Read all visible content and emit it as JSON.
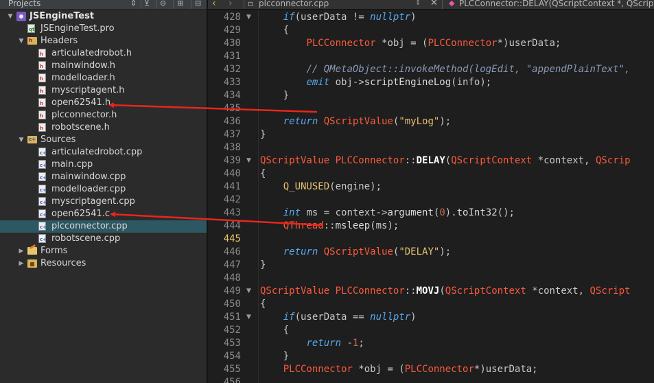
{
  "projects_panel": {
    "title": "Projects",
    "toolbar_icons": [
      "chevron-updown-icon",
      "filter-icon",
      "link-icon",
      "split-icon",
      "close-panel-icon"
    ],
    "tree": [
      {
        "label": "JSEngineTest",
        "depth": 0,
        "kind": "project",
        "expanded": true,
        "bold": true
      },
      {
        "label": "JSEngineTest.pro",
        "depth": 1,
        "kind": "pro"
      },
      {
        "label": "Headers",
        "depth": 1,
        "kind": "folder-h",
        "expanded": true
      },
      {
        "label": "articulatedrobot.h",
        "depth": 2,
        "kind": "h"
      },
      {
        "label": "mainwindow.h",
        "depth": 2,
        "kind": "h"
      },
      {
        "label": "modelloader.h",
        "depth": 2,
        "kind": "h"
      },
      {
        "label": "myscriptagent.h",
        "depth": 2,
        "kind": "h"
      },
      {
        "label": "open62541.h",
        "depth": 2,
        "kind": "h"
      },
      {
        "label": "plcconnector.h",
        "depth": 2,
        "kind": "h"
      },
      {
        "label": "robotscene.h",
        "depth": 2,
        "kind": "h"
      },
      {
        "label": "Sources",
        "depth": 1,
        "kind": "folder-c",
        "expanded": true
      },
      {
        "label": "articulatedrobot.cpp",
        "depth": 2,
        "kind": "c"
      },
      {
        "label": "main.cpp",
        "depth": 2,
        "kind": "c"
      },
      {
        "label": "mainwindow.cpp",
        "depth": 2,
        "kind": "c"
      },
      {
        "label": "modelloader.cpp",
        "depth": 2,
        "kind": "c"
      },
      {
        "label": "myscriptagent.cpp",
        "depth": 2,
        "kind": "c"
      },
      {
        "label": "open62541.c",
        "depth": 2,
        "kind": "c"
      },
      {
        "label": "plcconnector.cpp",
        "depth": 2,
        "kind": "c",
        "selected": true
      },
      {
        "label": "robotscene.cpp",
        "depth": 2,
        "kind": "c"
      },
      {
        "label": "Forms",
        "depth": 1,
        "kind": "folder-forms",
        "expanded": false
      },
      {
        "label": "Resources",
        "depth": 1,
        "kind": "folder-res",
        "expanded": false
      }
    ]
  },
  "editor": {
    "nav_back": "‹",
    "nav_forward": "›",
    "file_name": "plcconnector.cpp",
    "function_crumb": "PLCConnector::DELAY(QScriptContext *, QScriptE",
    "current_line": 445,
    "lines": [
      {
        "n": 428,
        "fold": true,
        "tokens": [
          [
            "    ",
            ""
          ],
          [
            "if",
            "kw"
          ],
          [
            "(userData != ",
            "id"
          ],
          [
            "nullptr",
            "kw"
          ],
          [
            ")",
            "id"
          ]
        ]
      },
      {
        "n": 429,
        "fold": false,
        "tokens": [
          [
            "    {",
            "id"
          ]
        ]
      },
      {
        "n": 430,
        "fold": false,
        "tokens": [
          [
            "        ",
            ""
          ],
          [
            "PLCConnector",
            "ty"
          ],
          [
            " *obj = (",
            "id"
          ],
          [
            "PLCConnector",
            "ty"
          ],
          [
            "*)userData;",
            "id"
          ]
        ]
      },
      {
        "n": 431,
        "fold": false,
        "tokens": []
      },
      {
        "n": 432,
        "fold": false,
        "tokens": [
          [
            "        ",
            ""
          ],
          [
            "// QMetaObject::invokeMethod(logEdit, \"appendPlainText\",",
            "cm"
          ]
        ]
      },
      {
        "n": 433,
        "fold": false,
        "tokens": [
          [
            "        ",
            ""
          ],
          [
            "emit",
            "kw"
          ],
          [
            " obj->",
            "id"
          ],
          [
            "scriptEngineLog",
            "fn"
          ],
          [
            "(info);",
            "id"
          ]
        ]
      },
      {
        "n": 434,
        "fold": false,
        "tokens": [
          [
            "    }",
            "id"
          ]
        ]
      },
      {
        "n": 435,
        "fold": false,
        "tokens": []
      },
      {
        "n": 436,
        "fold": false,
        "tokens": [
          [
            "    ",
            ""
          ],
          [
            "return",
            "kw"
          ],
          [
            " ",
            "id"
          ],
          [
            "QScriptValue",
            "ty"
          ],
          [
            "(",
            "id"
          ],
          [
            "\"myLog\"",
            "str"
          ],
          [
            ");",
            "id"
          ]
        ]
      },
      {
        "n": 437,
        "fold": false,
        "tokens": [
          [
            "}",
            "id"
          ]
        ]
      },
      {
        "n": 438,
        "fold": false,
        "tokens": []
      },
      {
        "n": 439,
        "fold": true,
        "tokens": [
          [
            "QScriptValue",
            "ty"
          ],
          [
            " ",
            "id"
          ],
          [
            "PLCConnector",
            "ty"
          ],
          [
            "::",
            "id"
          ],
          [
            "DELAY",
            "fnb"
          ],
          [
            "(",
            "id"
          ],
          [
            "QScriptContext",
            "ty"
          ],
          [
            " *context, ",
            "id"
          ],
          [
            "QScrip",
            "ty"
          ]
        ]
      },
      {
        "n": 440,
        "fold": false,
        "tokens": [
          [
            "{",
            "id"
          ]
        ]
      },
      {
        "n": 441,
        "fold": false,
        "tokens": [
          [
            "    ",
            ""
          ],
          [
            "Q_UNUSED",
            "mac"
          ],
          [
            "(engine);",
            "id"
          ]
        ]
      },
      {
        "n": 442,
        "fold": false,
        "tokens": []
      },
      {
        "n": 443,
        "fold": false,
        "tokens": [
          [
            "    ",
            ""
          ],
          [
            "int",
            "kw"
          ],
          [
            " ms = context->",
            "id"
          ],
          [
            "argument",
            "fn"
          ],
          [
            "(",
            "id"
          ],
          [
            "0",
            "num"
          ],
          [
            ").",
            "id"
          ],
          [
            "toInt32",
            "fn"
          ],
          [
            "();",
            "id"
          ]
        ]
      },
      {
        "n": 444,
        "fold": false,
        "tokens": [
          [
            "    ",
            ""
          ],
          [
            "QThread",
            "ty"
          ],
          [
            "::",
            "id"
          ],
          [
            "msleep",
            "fn"
          ],
          [
            "(ms);",
            "id"
          ]
        ]
      },
      {
        "n": 445,
        "fold": false,
        "tokens": []
      },
      {
        "n": 446,
        "fold": false,
        "tokens": [
          [
            "    ",
            ""
          ],
          [
            "return",
            "kw"
          ],
          [
            " ",
            "id"
          ],
          [
            "QScriptValue",
            "ty"
          ],
          [
            "(",
            "id"
          ],
          [
            "\"DELAY\"",
            "str"
          ],
          [
            ");",
            "id"
          ]
        ]
      },
      {
        "n": 447,
        "fold": false,
        "tokens": [
          [
            "}",
            "id"
          ]
        ]
      },
      {
        "n": 448,
        "fold": false,
        "tokens": []
      },
      {
        "n": 449,
        "fold": true,
        "tokens": [
          [
            "QScriptValue",
            "ty"
          ],
          [
            " ",
            "id"
          ],
          [
            "PLCConnector",
            "ty"
          ],
          [
            "::",
            "id"
          ],
          [
            "MOVJ",
            "fnb"
          ],
          [
            "(",
            "id"
          ],
          [
            "QScriptContext",
            "ty"
          ],
          [
            " *context, ",
            "id"
          ],
          [
            "QScript",
            "ty"
          ]
        ]
      },
      {
        "n": 450,
        "fold": false,
        "tokens": [
          [
            "{",
            "id"
          ]
        ]
      },
      {
        "n": 451,
        "fold": true,
        "tokens": [
          [
            "    ",
            ""
          ],
          [
            "if",
            "kw"
          ],
          [
            "(userData == ",
            "id"
          ],
          [
            "nullptr",
            "kw"
          ],
          [
            ")",
            "id"
          ]
        ]
      },
      {
        "n": 452,
        "fold": false,
        "tokens": [
          [
            "    {",
            "id"
          ]
        ]
      },
      {
        "n": 453,
        "fold": false,
        "tokens": [
          [
            "        ",
            ""
          ],
          [
            "return",
            "kw"
          ],
          [
            " -",
            "id"
          ],
          [
            "1",
            "num"
          ],
          [
            ";",
            "id"
          ]
        ]
      },
      {
        "n": 454,
        "fold": false,
        "tokens": [
          [
            "    }",
            "id"
          ]
        ]
      },
      {
        "n": 455,
        "fold": false,
        "tokens": [
          [
            "    ",
            ""
          ],
          [
            "PLCConnector",
            "ty"
          ],
          [
            " *obj = (",
            "id"
          ],
          [
            "PLCConnector",
            "ty"
          ],
          [
            "*)userData;",
            "id"
          ]
        ]
      },
      {
        "n": 456,
        "fold": false,
        "tokens": []
      }
    ]
  },
  "annotations": {
    "arrow_color": "#e8261c"
  }
}
